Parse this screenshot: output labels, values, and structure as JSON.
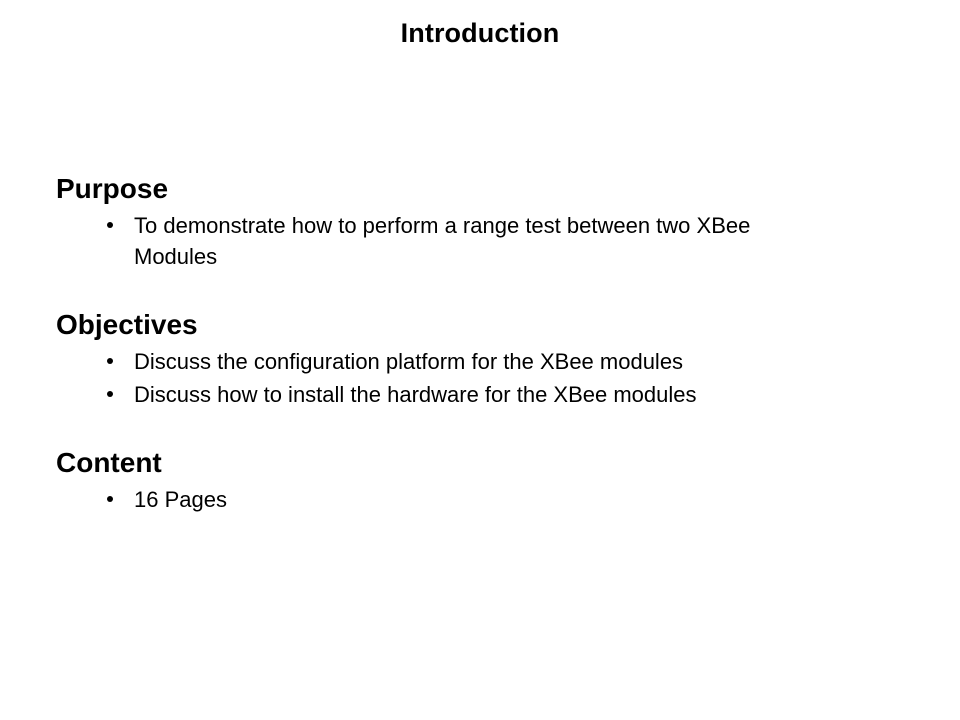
{
  "slide": {
    "title": "Introduction",
    "background_color": "#ffffff",
    "text_color": "#000000",
    "sections": [
      {
        "heading": "Purpose",
        "bullets": [
          "To demonstrate how to perform a range test between two XBee Modules"
        ]
      },
      {
        "heading": "Objectives",
        "bullets": [
          "Discuss the configuration platform for the XBee modules",
          "Discuss how to install the hardware for the XBee modules"
        ]
      },
      {
        "heading": "Content",
        "bullets": [
          "16 Pages"
        ]
      }
    ]
  }
}
